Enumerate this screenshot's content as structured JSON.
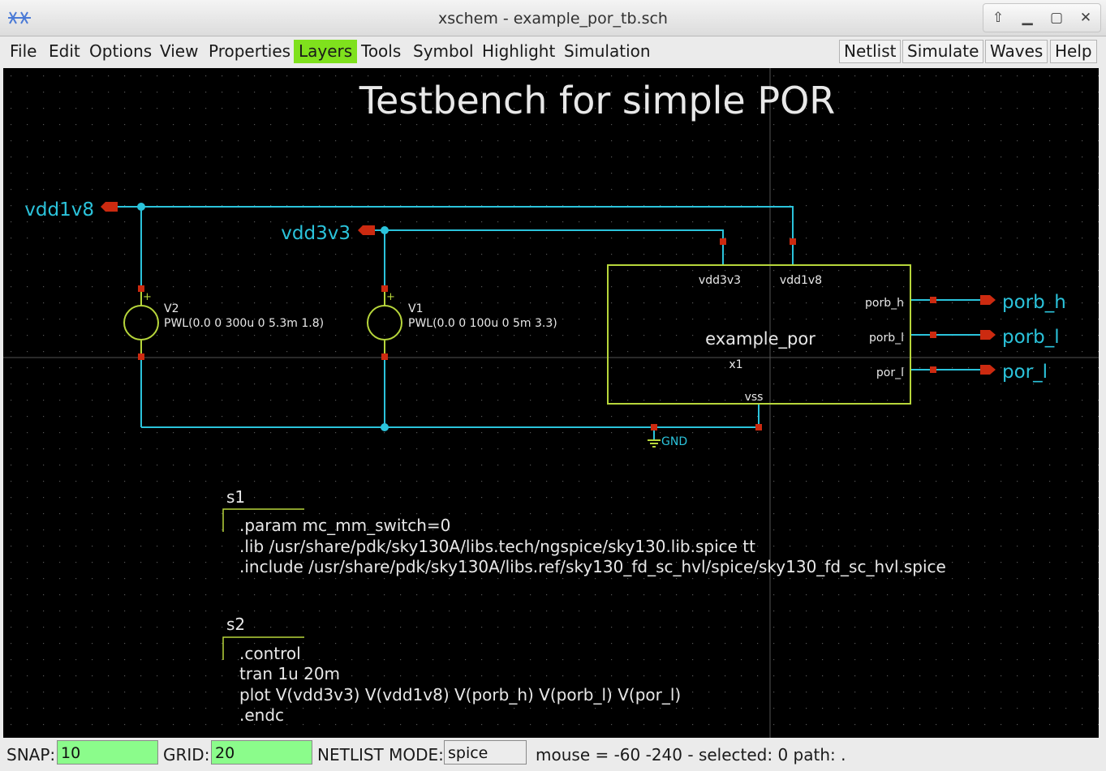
{
  "window": {
    "title": "xschem - example_por_tb.sch"
  },
  "icons": {
    "app": "xschem-logo-icon",
    "pin": "pin-up-icon",
    "minimize": "minimize-icon",
    "maximize": "maximize-icon",
    "close": "close-icon"
  },
  "menubar": {
    "items": [
      "File",
      "Edit",
      "Options",
      "View",
      "Properties",
      "Layers",
      "Tools",
      "Symbol",
      "Highlight",
      "Simulation"
    ],
    "active": "Layers",
    "buttons": [
      "Netlist",
      "Simulate",
      "Waves",
      "Help"
    ]
  },
  "schematic": {
    "title": "Testbench for simple POR",
    "labels": {
      "vdd1v8": "vdd1v8",
      "vdd3v3": "vdd3v3",
      "porb_h": "porb_h",
      "porb_l": "porb_l",
      "por_l": "por_l",
      "gnd": "GND"
    },
    "v2": {
      "name": "V2",
      "value": "PWL(0.0 0 300u 0 5.3m 1.8)"
    },
    "v1": {
      "name": "V1",
      "value": "PWL(0.0 0 100u 0 5m 3.3)"
    },
    "block": {
      "name": "example_por",
      "inst": "x1",
      "pins": {
        "vdd3v3": "vdd3v3",
        "vdd1v8": "vdd1v8",
        "porb_h": "porb_h",
        "porb_l": "porb_l",
        "por_l": "por_l",
        "vss": "vss"
      }
    },
    "s1": {
      "name": "s1",
      "lines": [
        ".param mc_mm_switch=0",
        ".lib /usr/share/pdk/sky130A/libs.tech/ngspice/sky130.lib.spice tt",
        ".include /usr/share/pdk/sky130A/libs.ref/sky130_fd_sc_hvl/spice/sky130_fd_sc_hvl.spice"
      ]
    },
    "s2": {
      "name": "s2",
      "lines": [
        ".control",
        "tran 1u 20m",
        "plot V(vdd3v3) V(vdd1v8) V(porb_h) V(porb_l) V(por_l)",
        ".endc"
      ]
    }
  },
  "statusbar": {
    "snap_label": "SNAP:",
    "snap": "10",
    "grid_label": "GRID:",
    "grid": "20",
    "mode_label": "NETLIST MODE:",
    "mode": "spice",
    "mouse": "mouse = -60 -240 - selected: 0 path: ."
  },
  "colors": {
    "wire": "#2bc3db",
    "pin": "#cc2a10",
    "symbol": "#b7d63b",
    "text": "#e8e8e8",
    "canvas": "#000000",
    "active_menu": "#7fe11d",
    "status_field": "#8bfc8b"
  }
}
